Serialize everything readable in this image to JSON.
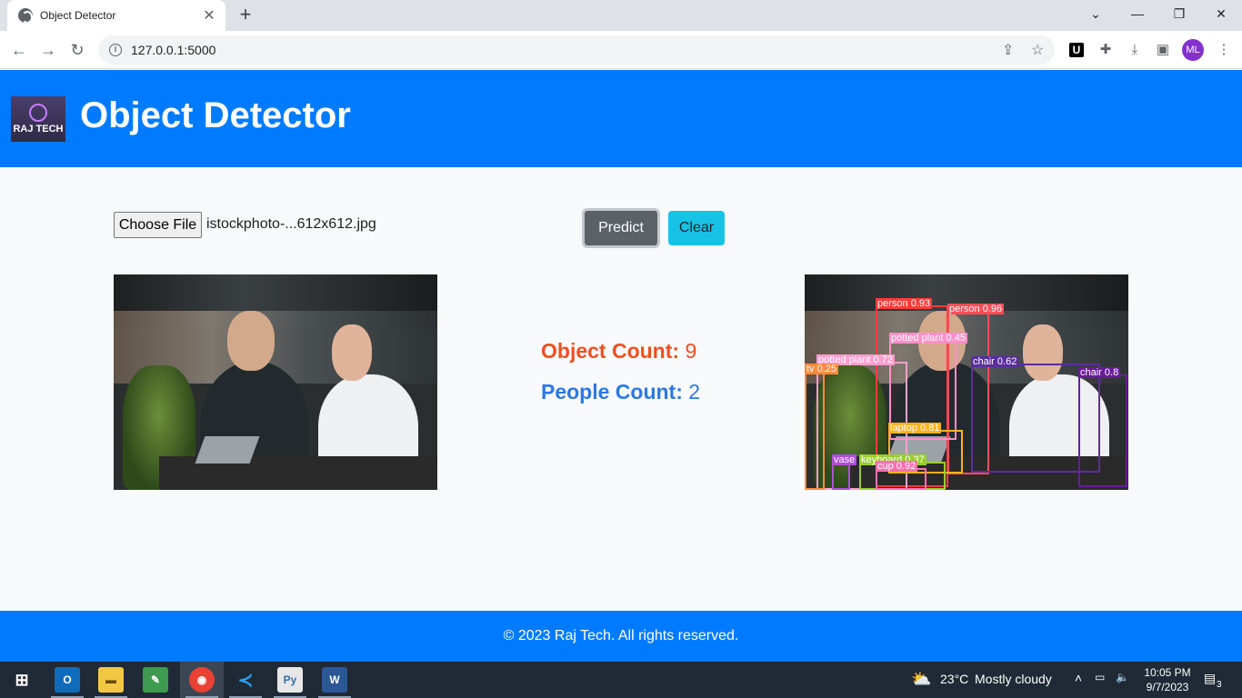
{
  "browser": {
    "tab_title": "Object Detector",
    "url": "127.0.0.1:5000",
    "profile_initials": "ML"
  },
  "header": {
    "logo_text": "RAJ TECH",
    "title": "Object Detector"
  },
  "upload": {
    "choose_file_label": "Choose File",
    "file_name": "istockphoto-...612x612.jpg"
  },
  "actions": {
    "predict_label": "Predict",
    "clear_label": "Clear"
  },
  "counts": {
    "object_label": "Object Count:",
    "object_value": "9",
    "people_label": "People Count:",
    "people_value": "2"
  },
  "detections": [
    {
      "label": "person 0.93",
      "color": "#ff3b3b"
    },
    {
      "label": "person 0.96",
      "color": "#ff4d5a"
    },
    {
      "label": "potted plant 0.45",
      "color": "#ff8fc8"
    },
    {
      "label": "potted plant 0.72",
      "color": "#ff9ecf"
    },
    {
      "label": "chair 0.62",
      "color": "#5b2d9e"
    },
    {
      "label": "chair 0.8",
      "color": "#6a1b9a"
    },
    {
      "label": "tv 0.25",
      "color": "#ff8a3d"
    },
    {
      "label": "laptop 0.81",
      "color": "#ffb21e"
    },
    {
      "label": "keyboard 0.37",
      "color": "#9acd32"
    },
    {
      "label": "cup 0.92",
      "color": "#ff6fb0"
    },
    {
      "label": "vase",
      "color": "#b14dd8"
    }
  ],
  "footer": {
    "text": "© 2023 Raj Tech. All rights reserved."
  },
  "taskbar": {
    "weather_temp": "23°C",
    "weather_desc": "Mostly cloudy",
    "time": "10:05 PM",
    "date": "9/7/2023",
    "notification_count": "3"
  }
}
